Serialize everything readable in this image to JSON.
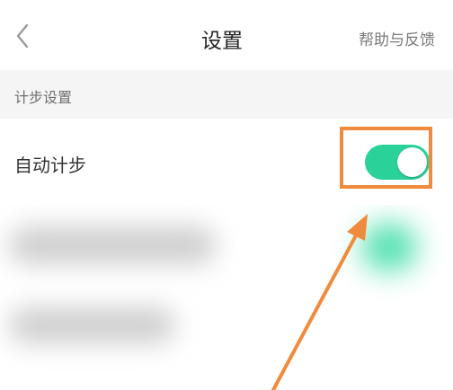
{
  "header": {
    "back_icon": "chevron-left-icon",
    "title": "设置",
    "help_link": "帮助与反馈"
  },
  "section": {
    "title": "计步设置"
  },
  "rows": [
    {
      "label": "自动计步",
      "toggle_on": true
    }
  ],
  "colors": {
    "toggle_on": "#2ad29a",
    "highlight": "#f08a3c",
    "section_bg": "#f5f5f5"
  }
}
